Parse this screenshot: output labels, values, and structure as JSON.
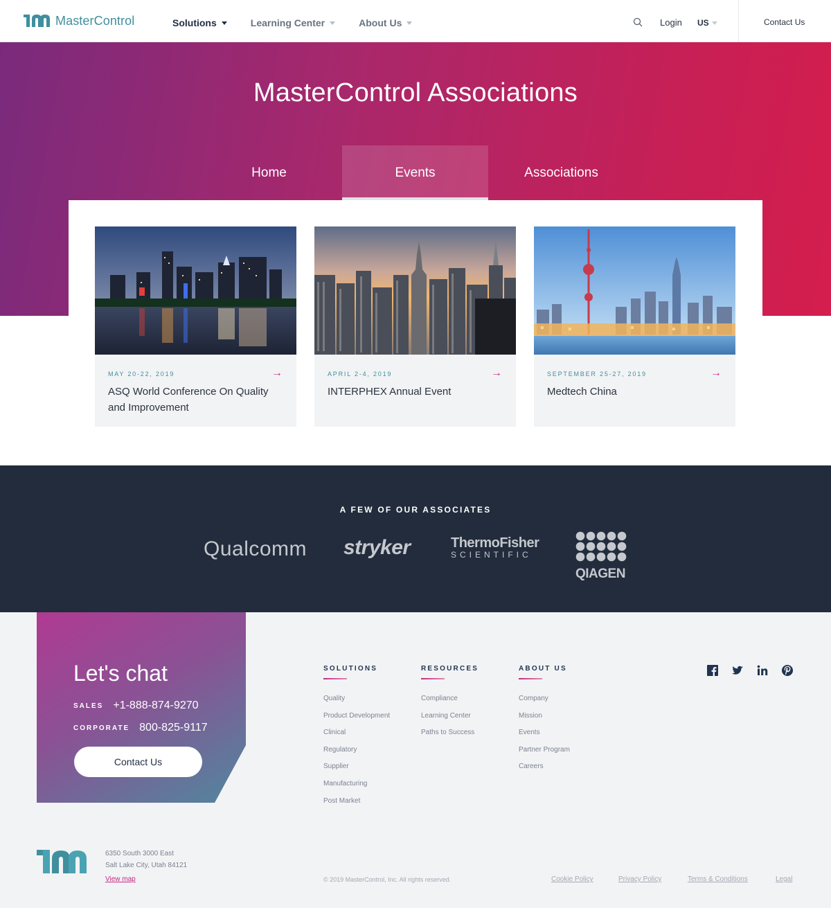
{
  "header": {
    "logo_text": "MasterControl",
    "nav": [
      {
        "label": "Solutions",
        "active": true
      },
      {
        "label": "Learning Center",
        "active": false
      },
      {
        "label": "About Us",
        "active": false
      }
    ],
    "login_label": "Login",
    "locale": "US",
    "contact_label": "Contact Us"
  },
  "hero": {
    "title": "MasterControl Associations",
    "tabs": [
      {
        "label": "Home",
        "active": false
      },
      {
        "label": "Events",
        "active": true
      },
      {
        "label": "Associations",
        "active": false
      }
    ]
  },
  "events": [
    {
      "date": "MAY 20-22, 2019",
      "title": "ASQ World Conference On Quality and Improvement",
      "arrow": "→"
    },
    {
      "date": "APRIL 2-4, 2019",
      "title": "INTERPHEX Annual Event",
      "arrow": "→"
    },
    {
      "date": "SEPTEMBER 25-27, 2019",
      "title": "Medtech China",
      "arrow": "→"
    }
  ],
  "associates": {
    "title": "A FEW OF OUR ASSOCIATES",
    "logos": {
      "qualcomm": "Qualcomm",
      "stryker": "stryker",
      "thermo_top": "ThermoFisher",
      "thermo_bottom": "SCIENTIFIC",
      "qiagen": "QIAGEN"
    }
  },
  "footer": {
    "chat": {
      "title": "Let's chat",
      "sales_label": "SALES",
      "sales_number": "+1-888-874-9270",
      "corporate_label": "CORPORATE",
      "corporate_number": "800-825-9117",
      "button": "Contact Us"
    },
    "columns": [
      {
        "heading": "SOLUTIONS",
        "links": [
          "Quality",
          "Product Development",
          "Clinical",
          "Regulatory",
          "Supplier",
          "Manufacturing",
          "Post Market"
        ]
      },
      {
        "heading": "RESOURCES",
        "links": [
          "Compliance",
          "Learning Center",
          "Paths to Success"
        ]
      },
      {
        "heading": "ABOUT US",
        "links": [
          "Company",
          "Mission",
          "Events",
          "Partner Program",
          "Careers"
        ]
      }
    ],
    "social": [
      "facebook-icon",
      "twitter-icon",
      "linkedin-icon",
      "pinterest-icon"
    ],
    "address_line1": "6350 South 3000 East",
    "address_line2": "Salt Lake City, Utah 84121",
    "view_map": "View map",
    "copyright": "© 2019 MasterControl, Inc. All rights reserved.",
    "legal_links": [
      "Cookie Policy",
      "Privacy Policy",
      "Terms & Conditions",
      "Legal"
    ]
  },
  "colors": {
    "brand_teal": "#3f8f9d",
    "accent_magenta": "#c22a82",
    "navy": "#222c3c",
    "hero_start": "#7a2a7c",
    "hero_end": "#d41e4d"
  }
}
